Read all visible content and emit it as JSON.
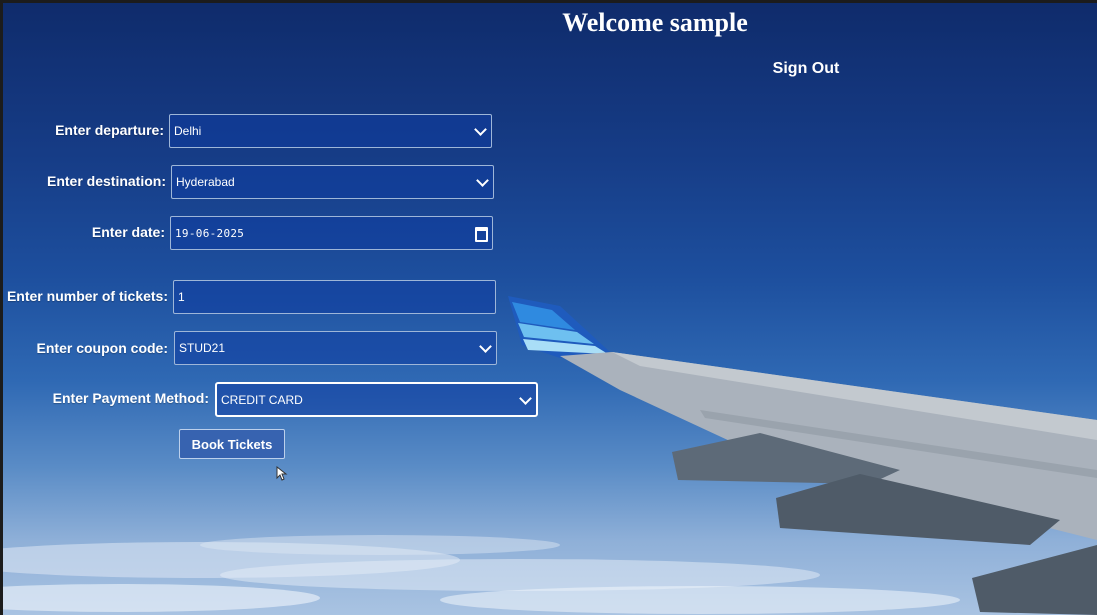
{
  "header": {
    "welcome_text": "Welcome sample",
    "signout_label": "Sign Out"
  },
  "form": {
    "departure": {
      "label": "Enter departure:",
      "value": "Delhi"
    },
    "destination": {
      "label": "Enter destination:",
      "value": "Hyderabad"
    },
    "date": {
      "label": "Enter date:",
      "value": "19-06-2025"
    },
    "tickets": {
      "label": "Enter number of tickets:",
      "value": "1"
    },
    "coupon": {
      "label": "Enter coupon code:",
      "value": "STUD21"
    },
    "payment": {
      "label": "Enter Payment Method:",
      "value": "CREDIT CARD"
    },
    "submit_label": "Book Tickets"
  },
  "icons": {
    "select_arrow": "chevron-down-icon",
    "date_picker": "calendar-icon",
    "pointer": "mouse-cursor-icon"
  },
  "colors": {
    "sky_top": "#0f2b6b",
    "sky_bottom": "#a9c3e2",
    "text": "#ffffff",
    "button_bg": "#3763b0"
  }
}
